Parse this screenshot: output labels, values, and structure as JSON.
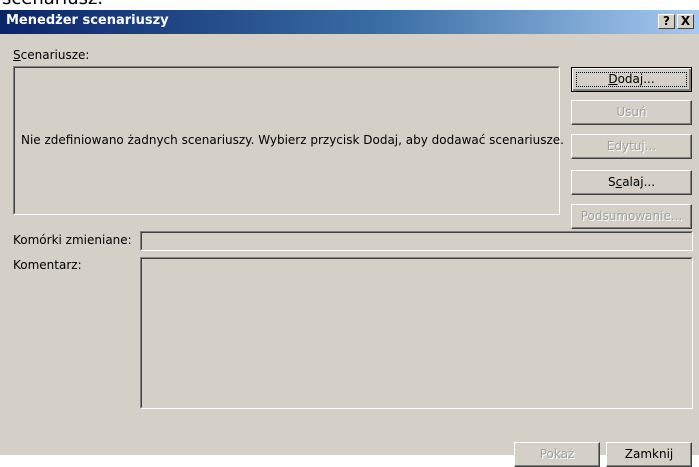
{
  "background_text": "scenariusz.",
  "window": {
    "title": "Menedżer scenariuszy",
    "help_button": "?",
    "close_button": "X"
  },
  "scenarios": {
    "label_mnemonic": "S",
    "label_rest": "cenariusze:",
    "empty_message": "Nie zdefiniowano żadnych scenariuszy. Wybierz przycisk Dodaj, aby dodawać scenariusze."
  },
  "buttons": {
    "add": {
      "mnemonic": "D",
      "rest": "odaj...",
      "enabled": true,
      "default": true
    },
    "delete": {
      "label": "Usuń",
      "enabled": false
    },
    "edit": {
      "label": "Edytuj...",
      "enabled": false
    },
    "merge": {
      "pre": "S",
      "mnemonic": "c",
      "rest": "alaj...",
      "enabled": true
    },
    "summary": {
      "label": "Podsumowanie...",
      "enabled": false
    },
    "show": {
      "label": "Pokaż",
      "enabled": false
    },
    "close": {
      "label": "Zamknij",
      "enabled": true
    }
  },
  "fields": {
    "changing_cells_label": "Komórki zmieniane:",
    "changing_cells_value": "",
    "comment_label": "Komentarz:",
    "comment_value": ""
  },
  "colors": {
    "dialog_bg": "#d4d0c8",
    "title_start": "#0a246a",
    "title_end": "#a6caf0",
    "disabled_text": "#a0a0a0"
  }
}
